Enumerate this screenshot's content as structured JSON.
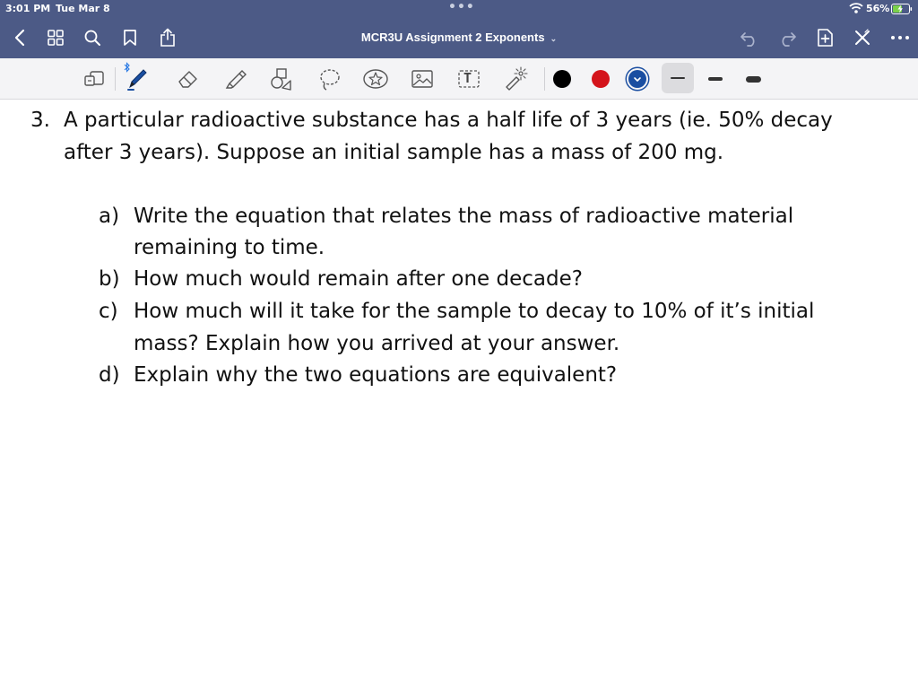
{
  "status_bar": {
    "time": "3:01 PM",
    "date": "Tue Mar 8",
    "more_dots": "•••",
    "battery_percent": "56%"
  },
  "nav_bar": {
    "title": "MCR3U Assignment 2 Exponents",
    "title_chevron": "⌄",
    "icons": [
      "back-chevron-icon",
      "thumbnails-grid-icon",
      "search-icon",
      "bookmark-icon",
      "share-icon",
      "undo-icon",
      "redo-icon",
      "add-page-icon",
      "close-pen-icon",
      "more-icon"
    ]
  },
  "toolbar": {
    "tools": [
      "zoom-box-icon",
      "pen-icon",
      "eraser-icon",
      "highlighter-icon",
      "shapes-icon",
      "lasso-icon",
      "sticker-icon",
      "image-icon",
      "text-icon",
      "laser-pointer-icon"
    ],
    "text_tool_label": "T",
    "colors": [
      "#000000",
      "#d4141b",
      "#1a4ea1"
    ],
    "selected_color": "#1a4ea1",
    "thicknesses": [
      "thin",
      "medium",
      "thick"
    ],
    "selected_thickness": "thin"
  },
  "document": {
    "question_number": "3.",
    "question_line1": "A particular radioactive substance has a half life of 3 years (ie. 50% decay",
    "question_line2": "after 3 years). Suppose an initial sample has a mass of 200 mg.",
    "parts": [
      {
        "label": "a)",
        "line1": "Write the equation that relates the mass of radioactive material",
        "line2": "remaining to time."
      },
      {
        "label": "b)",
        "line1": "How much would remain after one decade?",
        "line2": ""
      },
      {
        "label": "c)",
        "line1": "How much will it take for the sample to decay to 10% of it’s initial",
        "line2": "mass? Explain how you arrived at your answer."
      },
      {
        "label": "d)",
        "line1": "Explain why the two equations are equivalent?",
        "line2": ""
      }
    ]
  }
}
